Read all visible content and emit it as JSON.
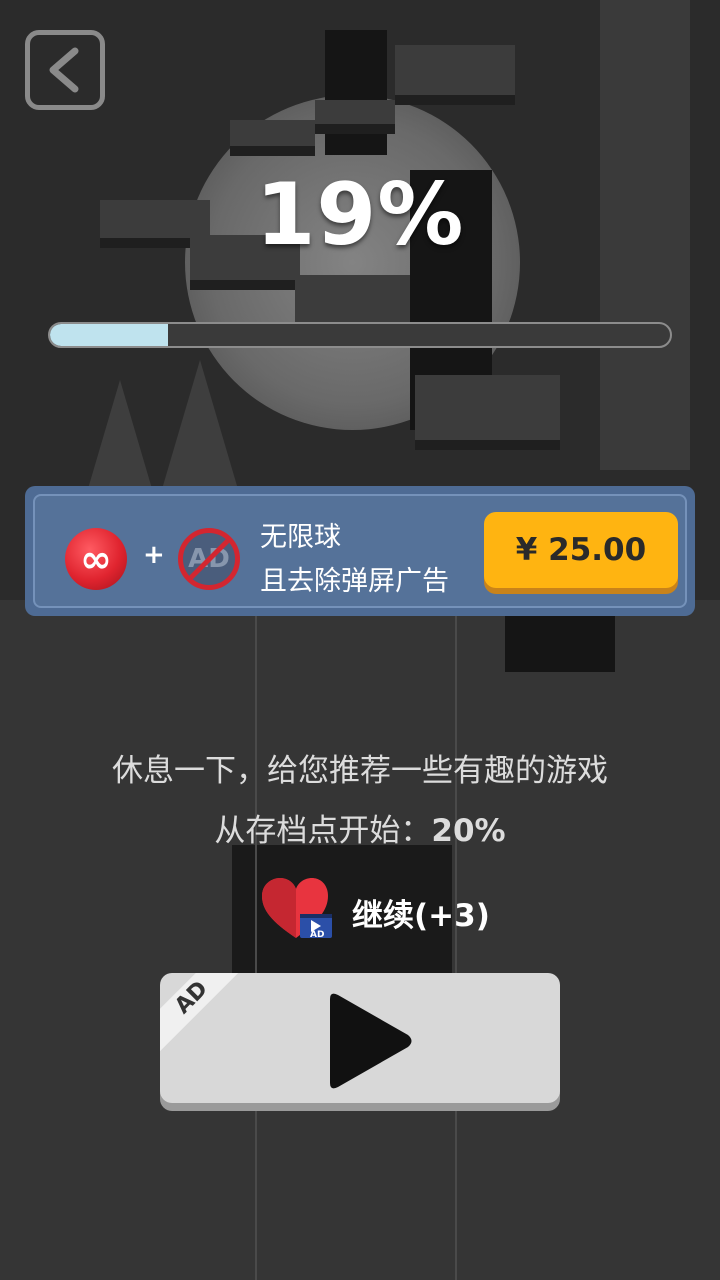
{
  "level": {
    "percent_text": "19%",
    "progress": 0.19
  },
  "offer": {
    "title": "无限球",
    "subtitle": "且去除弹屏广告",
    "price": "¥ 25.00",
    "infinity_symbol": "∞",
    "plus": "+",
    "noad_text": "AD"
  },
  "messages": {
    "rest": "休息一下，给您推荐一些有趣的游戏",
    "checkpoint_prefix": "从存档点开始：",
    "checkpoint_value": "20%"
  },
  "continue": {
    "label": "继续(+3)",
    "badge": "AD"
  },
  "play_button": {
    "ad_label": "AD"
  },
  "icons": {
    "back": "back-arrow-icon",
    "infinity": "infinite-ball-icon",
    "noad": "no-ad-icon",
    "heart": "heart-video-icon",
    "play": "play-icon"
  },
  "colors": {
    "progress_fill": "#bfe3ee",
    "offer_bg": "#4e6b94",
    "price_btn": "#ffb411",
    "heart": "#e8343f"
  }
}
